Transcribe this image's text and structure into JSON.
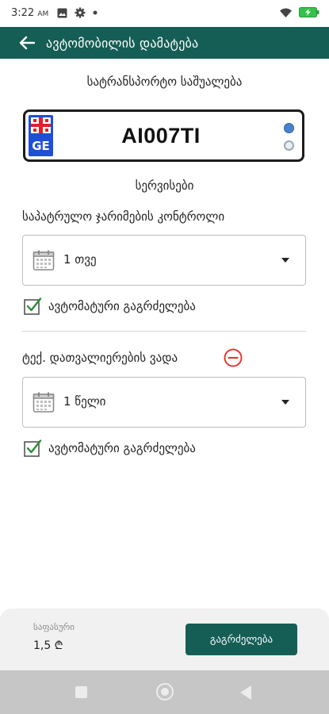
{
  "status_bar": {
    "time": "3:22",
    "ampm": "AM"
  },
  "app_bar": {
    "title": "ავტომობილის დამატება"
  },
  "vehicle": {
    "section_title": "სატრანსპორტო საშუალება",
    "plate_country": "GE",
    "plate_number": "AI007TI"
  },
  "services": {
    "section_title": "სერვისები",
    "items": [
      {
        "label": "საპატრულო ჯარიმების კონტროლი",
        "period": "1 თვე",
        "auto_renew_label": "ავტომატური გაგრძელება",
        "auto_renew_checked": true
      },
      {
        "label": "ტექ. დათვალიერების ვადა",
        "period": "1 წელი",
        "auto_renew_label": "ავტომატური გაგრძელება",
        "auto_renew_checked": true,
        "remove_icon": "minus-circle-icon"
      }
    ]
  },
  "footer": {
    "price_label": "საფასური",
    "price_value": "1,5 ₾",
    "continue_label": "გაგრძელება"
  },
  "colors": {
    "primary": "#155e55",
    "check": "#2e8b3a",
    "remove": "#e53935"
  }
}
